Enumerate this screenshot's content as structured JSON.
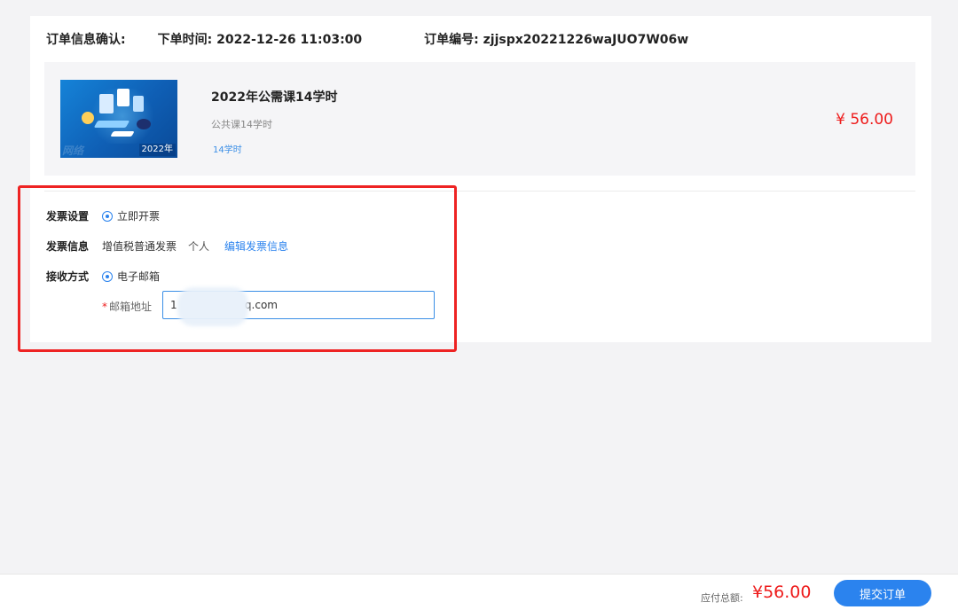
{
  "order": {
    "confirm_label": "订单信息确认:",
    "time_label": "下单时间:",
    "time_value": "2022-12-26 11:03:00",
    "number_label": "订单编号:",
    "number_value": "zjjspx20221226waJUO7W06w"
  },
  "course": {
    "thumbnail_badge": "2022年",
    "title": "2022年公需课14学时",
    "subtitle": "公共课14学时",
    "tag": "14学时",
    "price": "¥ 56.00"
  },
  "invoice": {
    "setting_label": "发票设置",
    "setting_option": "立即开票",
    "info_label": "发票信息",
    "info_type": "增值税普通发票",
    "info_holder": "个人",
    "edit_link": "编辑发票信息",
    "receive_label": "接收方式",
    "receive_option": "电子邮箱",
    "email_required_mark": "*",
    "email_label": "邮箱地址",
    "email_value": "1                    q.com"
  },
  "footer": {
    "total_label": "应付总额:",
    "total_value": "¥56.00",
    "submit_label": "提交订单"
  },
  "colors": {
    "accent": "#2b83ee",
    "price": "#ee1c1c",
    "highlight_box": "#ee2323"
  }
}
